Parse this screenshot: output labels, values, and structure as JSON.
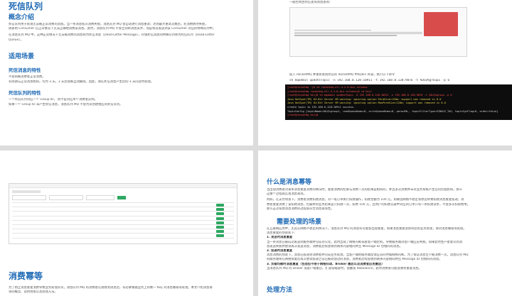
{
  "page1": {
    "title": "死信队列",
    "s1_heading": "概念介绍",
    "s1_paras": [
      "死信队列用于处理无法被正常消费的消息。当一条消息初次消费失败，消息队列 MQ 会自动进行消息重试；达到最大重试次数后，若消费依然失败，",
      "则表明 Consumer 在正常情况下无法正确地消费该消息。此时，消息队列 MQ 不会立刻将消息丢弃，而是将其发送到该 Consumer 对应的特殊队列中。",
      "",
      "在消息队列 MQ 中，这种正常情况下无法被消费的消息称为死信消息（Dead-Letter Message），存储死信消息的特殊队列称为死信队列（Dead-Letter",
      "Queue）。"
    ],
    "s2_heading": "适用场景",
    "s3_heading": "死信消息的特性",
    "s3_paras": [
      "不会再被消费者正常消费。",
      "有效期与正常消息相同，均为 3 天，3 天后会被自动删除。因此，请在死信消息产生后的 3 天内及时处理。"
    ],
    "s4_heading": "死信队列的特性",
    "s4_paras": [
      "一个死信队列对应一个 Group ID，  而不是对应单个消费者实例。",
      "如果一个 Group ID 未产生死信消息，消息队列 MQ 不会为其创建相应的死信队列。"
    ]
  },
  "page2": {
    "top_caption": "一般控制台死信查询消息查询：",
    "mid_caption": "提入 RocketMQ 并重新查找死信的 RocketMQ 中的/bin 目录，执行以下命令",
    "mid_cmd": "sh mqadmin   updateTopic -n 192.168.0.128:10911 -t 192.168.0.128:9876 -t %DLQ%group1 -p 6",
    "terminal": [
      {
        "c": "red",
        "t": "[root@rocketmq ~]# cd rocketmq-all-4.4.0-bin-release"
      },
      {
        "c": "red",
        "t": "[root@rocketmq rocketmq-all-4.4.0-bin-release]# cd bin/"
      },
      {
        "c": "red",
        "t": "[root@rocketmq bin]# sh mqadmin  updateTopic -b 192.168.0.128:10911 -n 192.168.0.128:9876 -t %DLQ%group -p 6"
      },
      {
        "c": "yel",
        "t": "Java HotSpot(TM) 64-Bit Server VM warning: ignoring option PermSize=128m; support was removed in 8.0"
      },
      {
        "c": "yel",
        "t": "Java HotSpot(TM) 64-Bit Server VM warning: ignoring option MaxPermSize=128m; support was removed in 8.0"
      },
      {
        "c": "wht",
        "t": "create topic to 192.168.0.128:10911 success."
      },
      {
        "c": "wht",
        "t": "TopicConfig [topicName=%DLQ%group1, readQueueNums=8, writeQueueNums=8, perm=RW-, topicFilterType=SINGLE_TAG, topicSysFlag=0, order=false]"
      },
      {
        "c": "red",
        "t": "[root@rocketmq bin]#"
      }
    ]
  },
  "page3": {
    "title": "消费幂等",
    "paras": [
      "为了防止消息重复消费导致业务处理异常，消息队列 MQ 的消费者在接收到消息后，有必要根据业务上的唯一 Key 对消息做幂等处理。本文介绍消息幂",
      "等的概念、适用场景以及处理方法。"
    ]
  },
  "page4": {
    "title": "什么是消息幂等",
    "paras": [
      "当出现消费者对某条消息重复消费的情况时，重复消费的结果与消费一次的结果是相同的，并且多次消费并未对业务系统产生任何负面影响，那么",
      "这整个过程就实现消息幂等。",
      "例如，在支付场景下，消费者消费扣款消息，对一笔订单执行扣款操作，扣款金额为 100 元。如果因网络不稳定等原因导致扣款消息重复投递，消",
      "费者重复消费了该扣款消息，但最终的业务结果是只扣款一次，扣费 100 元，且用户的扣款记录中对应的订单只有一条扣款流水，不会多次扣除费用。",
      "那么这次扣款消息消费的过程就符合消息幂等性。"
    ],
    "s2_heading": "需要处理的场景",
    "s2_paras": [
      "在互联网应用中，尤其在网络不稳定的情况下，消息队列 MQ 的消息有可能会出现重复，如果消息重复会影响您的业务处理，请对消息做幂等处理。",
      "消息重复的场景如下：",
      "1.  发送时消息重复",
      "当一条消息已被成功发送到服务端并完成持久化，此时出现了网络闪断或者客户端宕机，导致服务端对客户端应答失败。如果此时生产者意识到消",
      "息发送失败并尝试再次发送消息，消费者后续会收到两条内容相同并且 Message ID 也相同的消息。",
      "2.  投递时消息重复",
      "消息消费的场景下，消息已投递到消费者并完成业务处理，当客户端给服务端反馈应答的时候网络闪断。为了保证消息至少被消费一次，消息队列 MQ",
      "的服务端将在网络恢复后再次尝试投递之前已被处理过的消息，消费者后续会收到两条内容相同并且 Message ID 也相同的消息。",
      "3.  负载均衡时消息重复（包括但不限于网络抖动、Broker 重启以及消费者应用重启）",
      "当消息队列 MQ 的 Broker 或客户端重启、扩容或缩容时，会触发 Rebalance，此时消费者可能会收到重复消息。"
    ],
    "s3_heading": "处理方法"
  }
}
